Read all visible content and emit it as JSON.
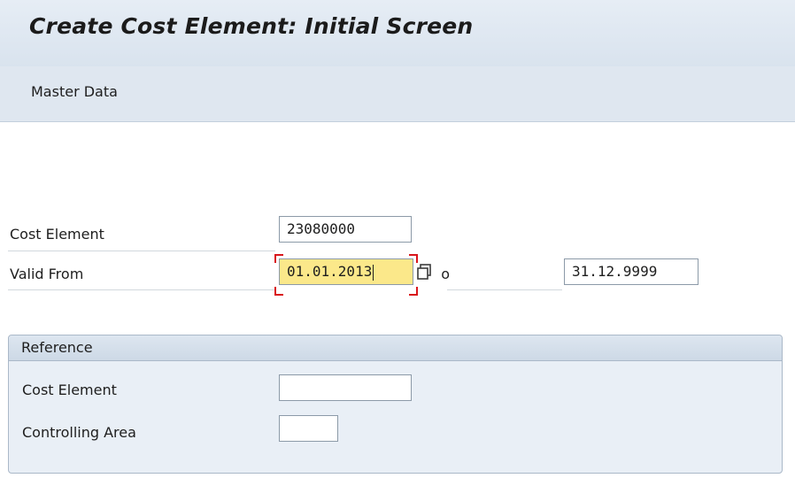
{
  "window": {
    "title": "Create Cost Element: Initial Screen"
  },
  "menu": {
    "master_data": "Master Data"
  },
  "form": {
    "cost_element": {
      "label": "Cost Element",
      "value": "23080000"
    },
    "valid_from": {
      "label": "Valid From",
      "value": "01.01.2013",
      "to_label": "to",
      "to_value": "31.12.9999"
    }
  },
  "reference": {
    "title": "Reference",
    "cost_element": {
      "label": "Cost Element",
      "value": ""
    },
    "controlling_area": {
      "label": "Controlling Area",
      "value": ""
    }
  },
  "colors": {
    "title_bar": "#dfe7f0",
    "focused_field": "#fbe88a",
    "focus_marker": "#d9161c",
    "groupbox_bg": "#e9eff6"
  },
  "icons": {
    "value_help": "copy-icon"
  }
}
